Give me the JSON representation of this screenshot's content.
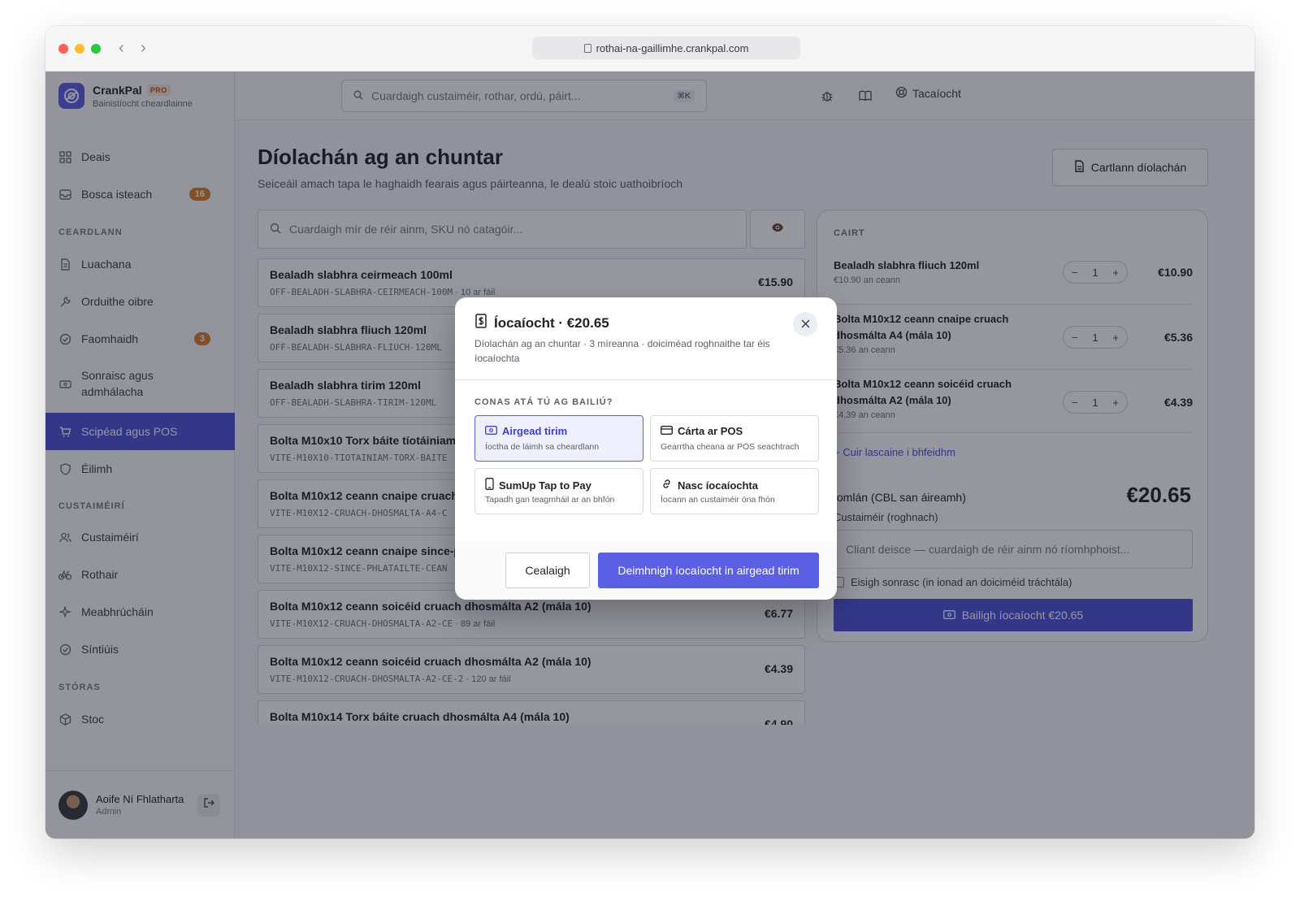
{
  "browser": {
    "url": "rothai-na-gaillimhe.crankpal.com"
  },
  "brand": {
    "name": "CrankPal",
    "badge": "PRO",
    "subtitle": "Bainistíocht cheardlainne"
  },
  "topbar": {
    "search_placeholder": "Cuardaigh custaiméir, rothar, ordú, páirt...",
    "shortcut": "⌘K",
    "support_label": "Tacaíocht"
  },
  "sidebar": {
    "items_top": [
      {
        "label": "Deais",
        "icon": "grid-icon"
      },
      {
        "label": "Bosca isteach",
        "icon": "inbox-icon",
        "badge": "16"
      }
    ],
    "section_workshop": "CEARDLANN",
    "items_workshop": [
      {
        "label": "Luachana",
        "icon": "document-icon"
      },
      {
        "label": "Orduithe oibre",
        "icon": "wrench-icon"
      },
      {
        "label": "Faomhaidh",
        "icon": "check-circle-icon",
        "badge": "3"
      },
      {
        "label": "Sonraisc agus admhálacha",
        "icon": "receipt-icon"
      },
      {
        "label": "Scipéad agus POS",
        "icon": "cart-icon",
        "active": true
      },
      {
        "label": "Éilimh",
        "icon": "shield-icon"
      }
    ],
    "section_customers": "CUSTAIMÉIRÍ",
    "items_customers": [
      {
        "label": "Custaiméirí",
        "icon": "users-icon"
      },
      {
        "label": "Rothair",
        "icon": "bike-icon"
      },
      {
        "label": "Meabhrúcháin",
        "icon": "sparkle-icon"
      },
      {
        "label": "Síntiúis",
        "icon": "check-circle-icon"
      }
    ],
    "section_store": "STÓRAS",
    "items_store": [
      {
        "label": "Stoc",
        "icon": "box-icon"
      }
    ],
    "user": {
      "name": "Aoife Ní Fhlatharta",
      "role": "Admin"
    }
  },
  "page": {
    "title": "Díolachán ag an chuntar",
    "subtitle": "Seiceáil amach tapa le haghaidh fearais agus páirteanna, le dealú stoic uathoibríoch",
    "archive_button": "Cartlann díolachán",
    "product_search_placeholder": "Cuardaigh mír de réir ainm, SKU nó catagóir..."
  },
  "products": [
    {
      "name": "Bealadh slabhra ceirmeach 100ml",
      "sku": "OFF-BEALADH-SLABHRA-CEIRMEACH-100M",
      "stock": "10 ar fáil",
      "price": "€15.90"
    },
    {
      "name": "Bealadh slabhra fliuch 120ml",
      "sku": "OFF-BEALADH-SLABHRA-FLIUCH-120ML",
      "stock": "",
      "price": ""
    },
    {
      "name": "Bealadh slabhra tirim 120ml",
      "sku": "OFF-BEALADH-SLABHRA-TIRIM-120ML",
      "stock": "",
      "price": ""
    },
    {
      "name": "Bolta M10x10 Torx báite tíotáiniam",
      "sku": "VITE-M10X10-TIOTAINIAM-TORX-BAITE",
      "stock": "",
      "price": ""
    },
    {
      "name": "Bolta M10x12 ceann cnaipe cruach",
      "sku": "VITE-M10X12-CRUACH-DHOSMALTA-A4-C",
      "stock": "",
      "price": ""
    },
    {
      "name": "Bolta M10x12 ceann cnaipe since-pl",
      "sku": "VITE-M10X12-SINCE-PHLATAILTE-CEAN",
      "stock": "",
      "price": ""
    },
    {
      "name": "Bolta M10x12 ceann soicéid cruach dhosmálta A2 (mála 10)",
      "sku": "VITE-M10X12-CRUACH-DHOSMALTA-A2-CE",
      "stock": "89 ar fáil",
      "price": "€6.77"
    },
    {
      "name": "Bolta M10x12 ceann soicéid cruach dhosmálta A2 (mála 10)",
      "sku": "VITE-M10X12-CRUACH-DHOSMALTA-A2-CE-2",
      "stock": "120 ar fáil",
      "price": "€4.39"
    },
    {
      "name": "Bolta M10x14 Torx báite cruach dhosmálta A4 (mála 10)",
      "sku": "",
      "stock": "",
      "price": "€4.90"
    }
  ],
  "cart": {
    "title": "CAIRT",
    "lines": [
      {
        "name": "Bealadh slabhra fliuch 120ml",
        "unit": "€10.90 an ceann",
        "qty": "1",
        "total": "€10.90"
      },
      {
        "name": "Bolta M10x12 ceann cnaipe cruach dhosmálta A4 (mála 10)",
        "unit": "€5.36 an ceann",
        "qty": "1",
        "total": "€5.36"
      },
      {
        "name": "Bolta M10x12 ceann soicéid cruach dhosmálta A2 (mála 10)",
        "unit": "€4.39 an ceann",
        "qty": "1",
        "total": "€4.39"
      }
    ],
    "discount_link": "+ Cuir lascaine i bhfeidhm",
    "total_label": "Iomlán (CBL san áireamh)",
    "total_value": "€20.65",
    "customer_label": "Custaiméir (roghnach)",
    "customer_placeholder": "Cliant deisce — cuardaigh de réir ainm nó ríomhphoist...",
    "invoice_label": "Eisigh sonrasc (in ionad an doiciméid tráchtála)",
    "collect_button": "Bailigh íocaíocht €20.65"
  },
  "modal": {
    "title": "Íocaíocht · €20.65",
    "subtitle": "Díolachán ag an chuntar · 3 míreanna · doiciméad roghnaithe tar éis íocaíochta",
    "question": "CONAS ATÁ TÚ AG BAILIÚ?",
    "options": [
      {
        "title": "Airgead tirim",
        "desc": "Íoctha de láimh sa cheardlann",
        "icon": "cash-icon",
        "selected": true
      },
      {
        "title": "Cárta ar POS",
        "desc": "Gearrtha cheana ar POS seachtrach",
        "icon": "card-icon",
        "selected": false
      },
      {
        "title": "SumUp Tap to Pay",
        "desc": "Tapadh gan teagmháil ar an bhfón",
        "icon": "phone-icon",
        "selected": false
      },
      {
        "title": "Nasc íocaíochta",
        "desc": "Íocann an custaiméir óna fhón",
        "icon": "link-icon",
        "selected": false
      }
    ],
    "cancel_button": "Cealaigh",
    "confirm_button": "Deimhnigh íocaíocht in airgead tirim"
  },
  "colors": {
    "accent": "#5b5fe3",
    "sidebar_active": "#4f52d8",
    "badge": "#d9822b"
  }
}
